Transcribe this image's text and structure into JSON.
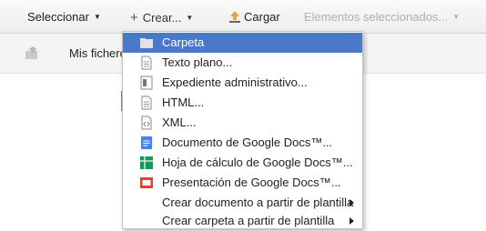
{
  "toolbar": {
    "select_label": "Seleccionar",
    "create_label": "Crear...",
    "upload_label": "Cargar",
    "selected_items_label": "Elementos seleccionados..."
  },
  "breadcrumb": {
    "label": "Mis ficheros"
  },
  "create_menu": {
    "items": [
      {
        "label": "Carpeta",
        "icon": "folder-icon",
        "highlighted": true
      },
      {
        "label": "Texto plano...",
        "icon": "text-file-icon"
      },
      {
        "label": "Expediente administrativo...",
        "icon": "record-file-icon"
      },
      {
        "label": "HTML...",
        "icon": "html-file-icon"
      },
      {
        "label": "XML...",
        "icon": "xml-file-icon"
      },
      {
        "label": "Documento de Google Docs™...",
        "icon": "google-docs-icon"
      },
      {
        "label": "Hoja de cálculo de Google Docs™...",
        "icon": "google-sheets-icon"
      },
      {
        "label": "Presentación de Google Docs™...",
        "icon": "google-slides-icon"
      },
      {
        "label": "Crear documento a partir de plantilla",
        "icon": "submenu-arrow-icon"
      },
      {
        "label": "Crear carpeta a partir de plantilla",
        "icon": "submenu-arrow-icon"
      }
    ]
  },
  "colors": {
    "highlight": "#4a79c9",
    "docs_blue": "#4285f4",
    "sheets_green": "#0f9d58",
    "slides_red": "#db4437",
    "disabled_text": "#b0b0b0"
  }
}
